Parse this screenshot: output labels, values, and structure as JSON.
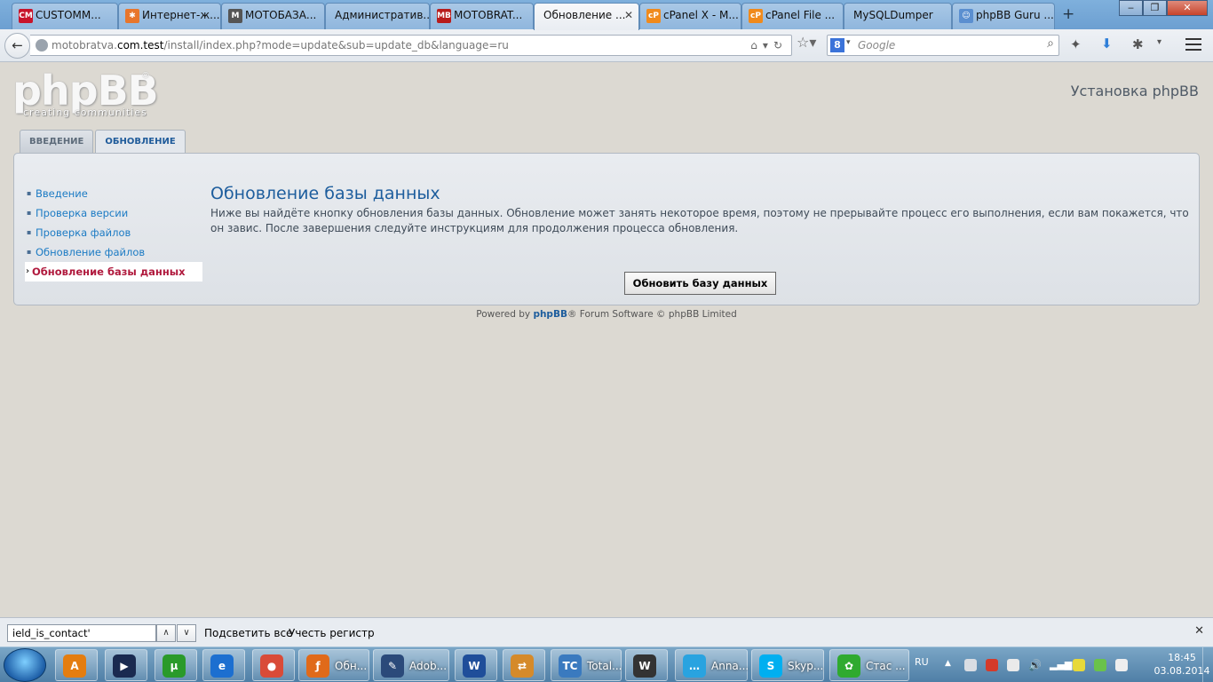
{
  "browser": {
    "tabs": [
      {
        "label": "CUSTOMM...",
        "icon": "cm-icon",
        "icon_text": "CM",
        "color": "#c8142b"
      },
      {
        "label": "Интернет-ж...",
        "icon": "joomla-icon",
        "icon_text": "✱",
        "color": "#e8762c"
      },
      {
        "label": "МОТОБАЗА...",
        "icon": "mb-icon",
        "icon_text": "M",
        "color": "#555555"
      },
      {
        "label": "Административ...",
        "icon": "",
        "icon_text": "",
        "color": ""
      },
      {
        "label": "MOTOBRAT...",
        "icon": "mb-red-icon",
        "icon_text": "MB",
        "color": "#b81c1c"
      },
      {
        "label": "Обновление ...",
        "icon": "",
        "icon_text": "",
        "color": "",
        "active": true
      },
      {
        "label": "cPanel X - M...",
        "icon": "cpanel-icon",
        "icon_text": "cP",
        "color": "#f08a1c"
      },
      {
        "label": "cPanel File ...",
        "icon": "cpanel-icon",
        "icon_text": "cP",
        "color": "#f08a1c"
      },
      {
        "label": "MySQLDumper",
        "icon": "",
        "icon_text": "",
        "color": ""
      },
      {
        "label": "phpBB Guru ...",
        "icon": "users-icon",
        "icon_text": "☺",
        "color": "#5b8fd0"
      }
    ],
    "new_tab": "+",
    "url": {
      "prefix": "motobratva.",
      "domain": "com.test",
      "path": "/install/index.php?mode=update&sub=update_db&language=ru"
    },
    "search_placeholder": "Google",
    "search_engine_letter": "8"
  },
  "page": {
    "logo_text": "phpBB",
    "logo_reg": "®",
    "logo_tagline": "creating  communities",
    "site_title": "Установка phpBB",
    "tabs": [
      "ВВЕДЕНИЕ",
      "ОБНОВЛЕНИЕ"
    ],
    "sidebar": [
      {
        "label": "Введение"
      },
      {
        "label": "Проверка версии"
      },
      {
        "label": "Проверка файлов"
      },
      {
        "label": "Обновление файлов"
      },
      {
        "label": "Обновление базы данных",
        "current": true
      }
    ],
    "heading": "Обновление базы данных",
    "description": "Ниже вы найдёте кнопку обновления базы данных. Обновление может занять некоторое время, поэтому не прерывайте процесс его выполнения, если вам покажется, что он завис. После завершения следуйте инструкциям для продолжения процесса обновления.",
    "button_label": "Обновить базу данных",
    "footer": {
      "prefix": "Powered by ",
      "brand": "phpBB",
      "suffix": "® Forum Software © phpBB Limited"
    }
  },
  "findbar": {
    "value": "ield_is_contact'",
    "highlight_all": "Подсветить все",
    "match_case": "Учесть регистр"
  },
  "taskbar": {
    "buttons": [
      {
        "label": "",
        "icon": "avast-icon",
        "color": "#e47d10",
        "icon_text": "A"
      },
      {
        "label": "",
        "icon": "media-player-icon",
        "color": "#1a2a50",
        "icon_text": "▶"
      },
      {
        "label": "",
        "icon": "utorrent-icon",
        "color": "#2a9a2a",
        "icon_text": "µ"
      },
      {
        "label": "",
        "icon": "ie-icon",
        "color": "#1c6fd0",
        "icon_text": "e"
      },
      {
        "label": "",
        "icon": "chrome-icon",
        "color": "#d94b38",
        "icon_text": "●"
      },
      {
        "label": "Обн...",
        "icon": "firefox-icon",
        "color": "#e06a1a",
        "icon_text": "ƒ"
      },
      {
        "label": "Adob...",
        "icon": "adobe-icon",
        "color": "#2b4a7a",
        "icon_text": "✎"
      },
      {
        "label": "",
        "icon": "word-icon",
        "color": "#1f4e9a",
        "icon_text": "W"
      },
      {
        "label": "",
        "icon": "transfer-icon",
        "color": "#d58a2a",
        "icon_text": "⇄"
      },
      {
        "label": "Total...",
        "icon": "total-commander-icon",
        "color": "#3a7abf",
        "icon_text": "TC"
      },
      {
        "label": "",
        "icon": "world-of-tanks-icon",
        "color": "#333333",
        "icon_text": "W"
      },
      {
        "label": "Anna...",
        "icon": "chat-icon",
        "color": "#29a3e0",
        "icon_text": "…"
      },
      {
        "label": "Skyp...",
        "icon": "skype-icon",
        "color": "#00aff0",
        "icon_text": "S"
      },
      {
        "label": "Стас ...",
        "icon": "icq-icon",
        "color": "#2faa2f",
        "icon_text": "✿"
      }
    ],
    "lang": "RU",
    "time": "18:45",
    "date": "03.08.2014"
  }
}
